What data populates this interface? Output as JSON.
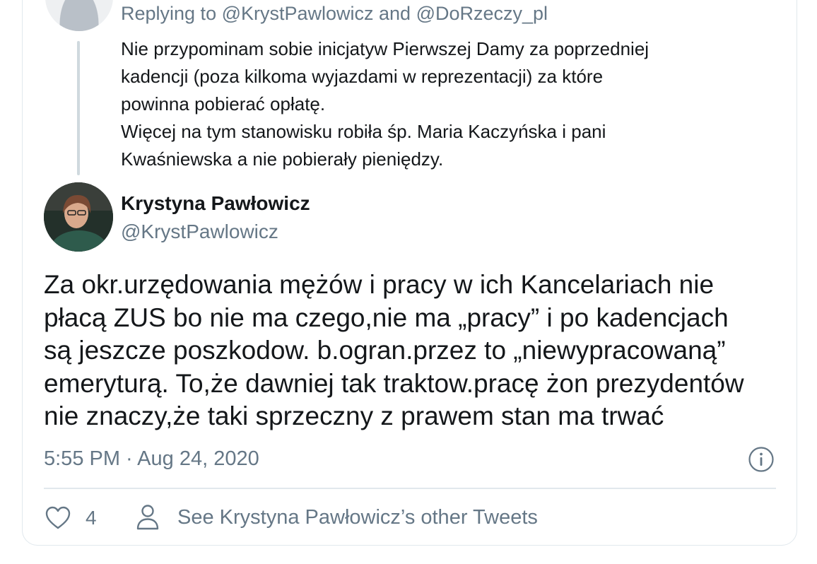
{
  "parent": {
    "replying_to": "Replying to @KrystPawlowicz and @DoRzeczy_pl",
    "lines": [
      "Nie przypominam sobie inicjatyw Pierwszej Damy za poprzedniej",
      "kadencji (poza kilkoma wyjazdami w reprezentacji) za które",
      "powinna pobierać opłatę.",
      "Więcej na tym stanowisku robiła śp. Maria Kaczyńska i pani",
      "Kwaśniewska a nie pobierały pieniędzy."
    ]
  },
  "tweet": {
    "author_name": "Krystyna Pawłowicz",
    "author_handle": "@KrystPawlowicz",
    "lines": [
      "Za okr.urzędowania mężów i pracy w ich Kancelariach nie",
      "płacą ZUS bo nie ma czego,nie ma „pracy” i po kadencjach",
      "są jeszcze poszkodow. b.ogran.przez to „niewypracowaną”",
      "emeryturą. To,że dawniej tak traktow.pracę żon prezydentów",
      "nie znaczy,że taki sprzeczny z prawem stan ma trwać"
    ],
    "timestamp": "5:55 PM · Aug 24, 2020",
    "like_count": "4",
    "other_tweets_label": "See Krystyna Pawłowicz’s other Tweets"
  },
  "icons": {
    "info": "info-icon",
    "like": "heart-icon",
    "profile": "person-icon"
  },
  "colors": {
    "text": "#14171a",
    "secondary": "#657786",
    "border": "#e1e8ed"
  }
}
